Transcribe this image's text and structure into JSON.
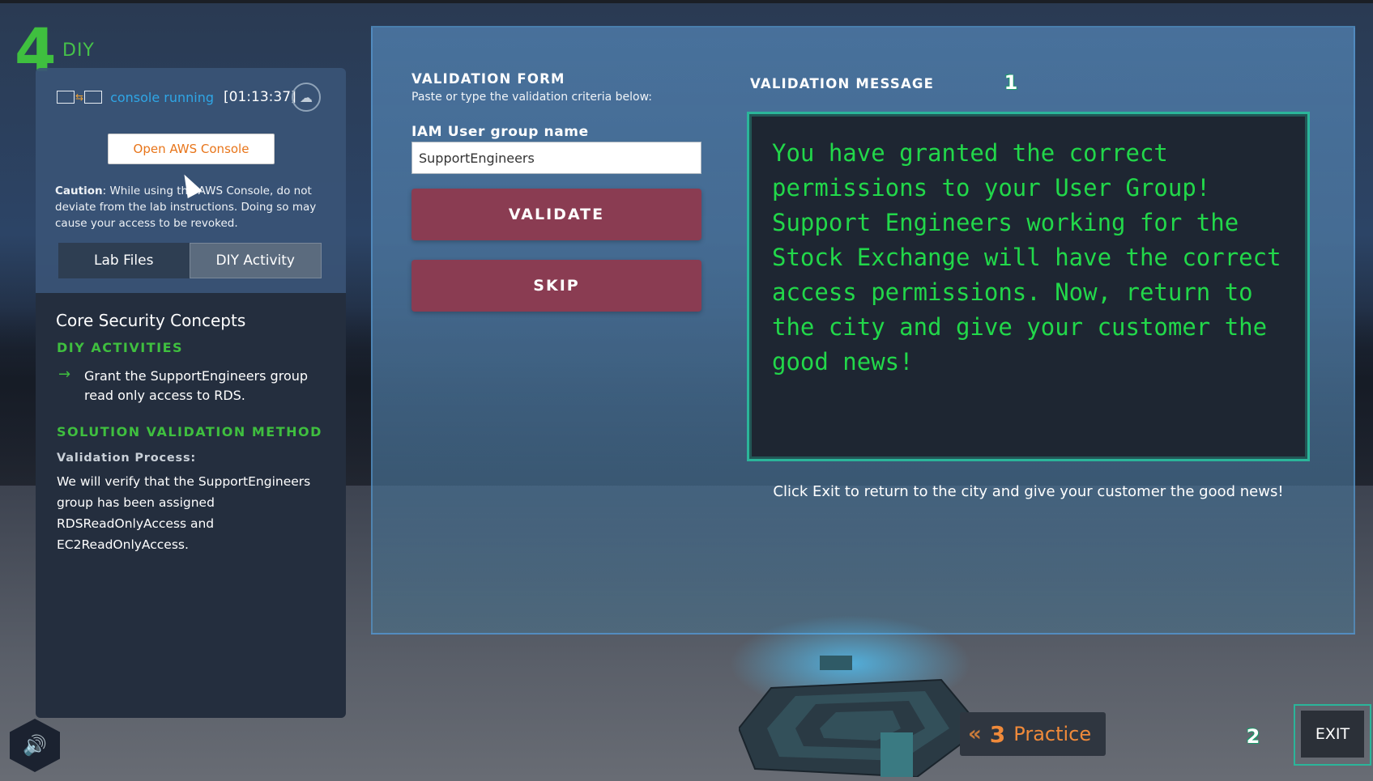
{
  "diy": {
    "number": "4",
    "label": "DIY"
  },
  "console": {
    "status": "console running",
    "timer": "[01:13:37]",
    "open_button": "Open AWS Console"
  },
  "caution": {
    "label": "Caution",
    "text": ": While using the AWS Console, do not deviate from the lab instructions. Doing so may cause your access to be revoked."
  },
  "tabs": [
    {
      "label": "Lab Files",
      "active": false
    },
    {
      "label": "DIY Activity",
      "active": true
    }
  ],
  "activity": {
    "title": "Core Security Concepts",
    "diy_heading": "DIY ACTIVITIES",
    "items": [
      "Grant the SupportEngineers group read only access to RDS."
    ],
    "solution_heading": "SOLUTION VALIDATION METHOD",
    "process_label": "Validation Process:",
    "process_text": "We will verify that the SupportEngineers group has been assigned RDSReadOnlyAccess and EC2ReadOnlyAccess."
  },
  "form": {
    "title": "VALIDATION FORM",
    "subtitle": "Paste or type the validation criteria below:",
    "field_label": "IAM User group name",
    "field_value": "SupportEngineers",
    "validate_label": "VALIDATE",
    "skip_label": "SKIP"
  },
  "message": {
    "title": "VALIDATION MESSAGE",
    "body": "You have granted the correct permissions to your User Group! Support Engineers working for the Stock Exchange will have the correct access permissions. Now, return to the city and give your customer the good news!",
    "hint": "Click Exit to return to the city and give your customer the good news!"
  },
  "badges": {
    "one": "1",
    "two": "2"
  },
  "practice": {
    "number": "3",
    "label": "Practice"
  },
  "exit_label": "EXIT",
  "icons": {
    "console": "console-connection-icon",
    "cloud": "cloud-icon",
    "arrow": "arrow-right-icon",
    "sound": "speaker-icon",
    "back": "double-chevron-left-icon"
  },
  "colors": {
    "accent_green": "#3fbf3f",
    "message_green": "#22d84a",
    "button_maroon": "#8a3c52",
    "teal_border": "#2bb59a",
    "console_blue": "#2fa6e6",
    "practice_orange": "#f08a3a"
  }
}
